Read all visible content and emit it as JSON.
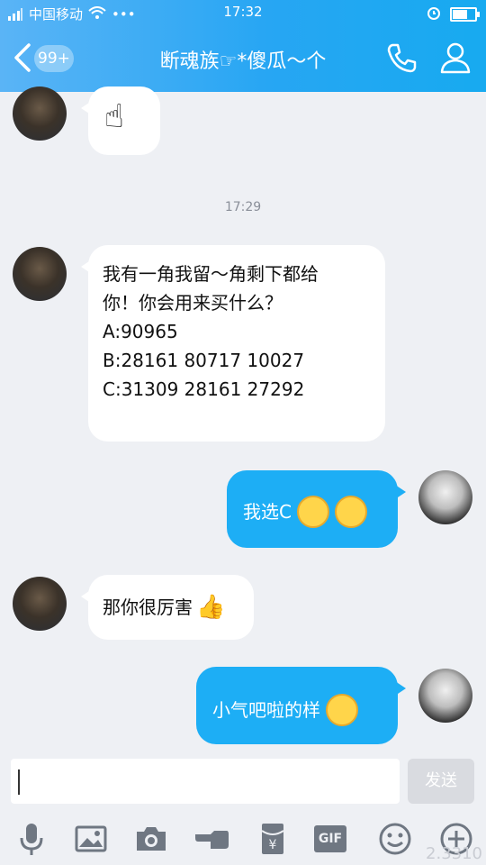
{
  "status_bar": {
    "left": "中国移动",
    "time": "17:32",
    "battery_level": 0.65
  },
  "header": {
    "back_badge": "99+",
    "title": "断魂族☞*傻瓜〜个"
  },
  "chat": {
    "timestamp": "17:29",
    "messages": [
      {
        "from": "other",
        "type": "emoji",
        "content": "☝"
      },
      {
        "from": "other",
        "type": "text",
        "lines": [
          "我有⼀角我留〜角剩下都给",
          "你！你会用来买什么？",
          "A:90965",
          "B:28161  80717  10027",
          "C:31309  28161  27292"
        ]
      },
      {
        "from": "me",
        "type": "text",
        "text": "我选C"
      },
      {
        "from": "other",
        "type": "text",
        "text": "那你很厉害"
      },
      {
        "from": "me",
        "type": "text",
        "text": "小气吧啦的样"
      }
    ]
  },
  "input": {
    "placeholder": "",
    "send_label": "发送"
  },
  "toolbar": {
    "gif_label": "GIF",
    "money_symbol": "¥"
  },
  "watermark": "2.3310"
}
